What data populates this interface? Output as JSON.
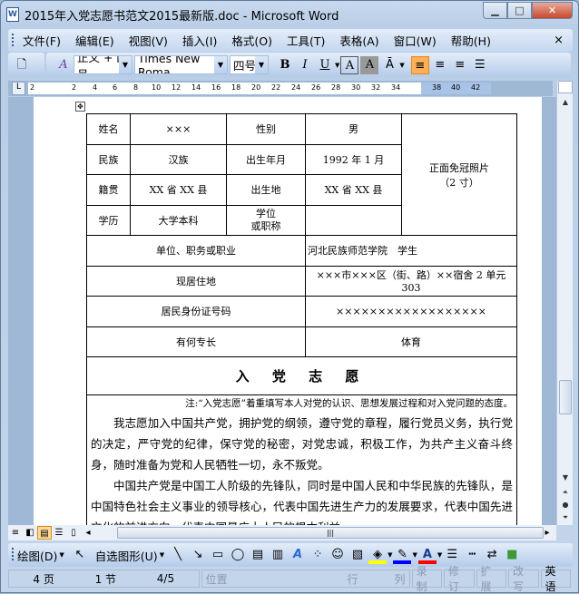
{
  "window": {
    "title": "2015年入党志愿书范文2015最新版.doc - Microsoft Word",
    "app_icon": "W",
    "minimize": "▁",
    "maximize": "□",
    "close": "✕"
  },
  "menu": [
    "文件(F)",
    "编辑(E)",
    "视图(V)",
    "插入(I)",
    "格式(O)",
    "工具(T)",
    "表格(A)",
    "窗口(W)",
    "帮助(H)"
  ],
  "menu_close": "×",
  "toolbar": {
    "style": "正文 + 四号",
    "font": "Times New Roma",
    "size": "四号",
    "bold": "B",
    "italic": "I",
    "underline": "U",
    "border_char": "A",
    "shade_char": "A"
  },
  "ruler": {
    "numbers": [
      "2",
      "2",
      "4",
      "6",
      "8",
      "10",
      "12",
      "14",
      "16",
      "18",
      "20",
      "22",
      "24",
      "26",
      "28",
      "30",
      "32",
      "34",
      "38",
      "40",
      "42"
    ]
  },
  "table": {
    "r1": [
      "姓名",
      "×××",
      "性别",
      "男"
    ],
    "photo": [
      "正面免冠照片",
      "（2 寸）"
    ],
    "r2": [
      "民族",
      "汉族",
      "出生年月",
      "1992 年 1 月"
    ],
    "r3": [
      "籍贯",
      "XX 省 XX 县",
      "出生地",
      "XX 省 XX 县"
    ],
    "r4": [
      "学历",
      "大学本科",
      "学位",
      "或职称",
      ""
    ],
    "r5": [
      "单位、职务或职业",
      "河北民族师范学院　学生"
    ],
    "r6": [
      "现居住地",
      "×××市×××区（街、路）××宿舍 2 单元 303"
    ],
    "r7": [
      "居民身份证号码",
      "××××××××××××××××××"
    ],
    "r8": [
      "有何专长",
      "体育"
    ],
    "heading": "入 党 志 愿"
  },
  "body": {
    "note": "注:“入党志愿”着重填写本人对党的认识、思想发展过程和对入党问题的态度。",
    "p1": "我志愿加入中国共产党，拥护党的纲领，遵守党的章程，履行党员义务，执行党的决定，严守党的纪律，保守党的秘密，对党忠诚，积极工作，为共产主义奋斗终身，随时准备为党和人民牺牲一切，永不叛党。",
    "p2": "中国共产党是中国工人阶级的先锋队，同时是中国人民和中华民族的先锋队，是中国特色社会主义事业的领导核心，代表中国先进生产力的发展要求，代表中国先进文化的前进方向，代表中国最广大人民的根本利益。"
  },
  "draw": {
    "draw_label": "绘图(D)",
    "autoshape_label": "自选图形(U)",
    "fill_color": "#ffff00",
    "line_color": "#0000ff",
    "font_color": "#ff0000"
  },
  "status": {
    "page": "4 页",
    "section": "1 节",
    "pages": "4/5",
    "position": "位置",
    "line": "行",
    "col": "列",
    "rec": "录制",
    "trk": "修订",
    "ext": "扩展",
    "ovr": "改写",
    "lang": "英语"
  }
}
